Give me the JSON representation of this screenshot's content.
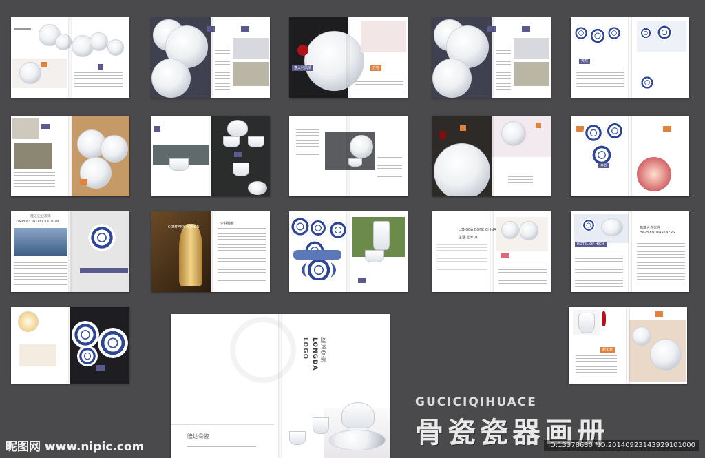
{
  "title": {
    "english": "GUCICIQIHUACE",
    "chinese": "骨瓷瓷器画册"
  },
  "watermark": {
    "site": "昵图网 www.nipic.com",
    "id_text": "ID:13378630 NO:20140923143929101000"
  },
  "cover": {
    "brand_en": "LONGDA",
    "brand_cn": "隆达骨瓷",
    "logo_side": "LOGO",
    "footer_name": "隆达骨瓷"
  },
  "spread_labels": {
    "s3_band": "意大利风情",
    "s3_band2": "万物",
    "s5_band": "天然",
    "s11_band": "百合",
    "s13_heading": "COMPANY INTRODUCTION",
    "s13_cn": "隆达企业故事",
    "s14_heading": "COMPANY HONOR",
    "s14_cn": "企业荣誉",
    "s16_heading": "LONGDA BONE CHINA",
    "s16_cn": "生活·艺术·家",
    "s17_heading": "HIGH-ENDPARTNERS",
    "s17_cn": "高端合作伙伴",
    "s17_band": "HOTEL OF HIGH",
    "s19_band": "新年家"
  },
  "colors": {
    "background": "#4a4a4c",
    "accent_purple": "#5b5a8e",
    "accent_orange": "#e2813a",
    "accent_pink": "#d86c7a",
    "accent_blue": "#3e5aa6",
    "dark_panel": "#2b2b2d"
  }
}
